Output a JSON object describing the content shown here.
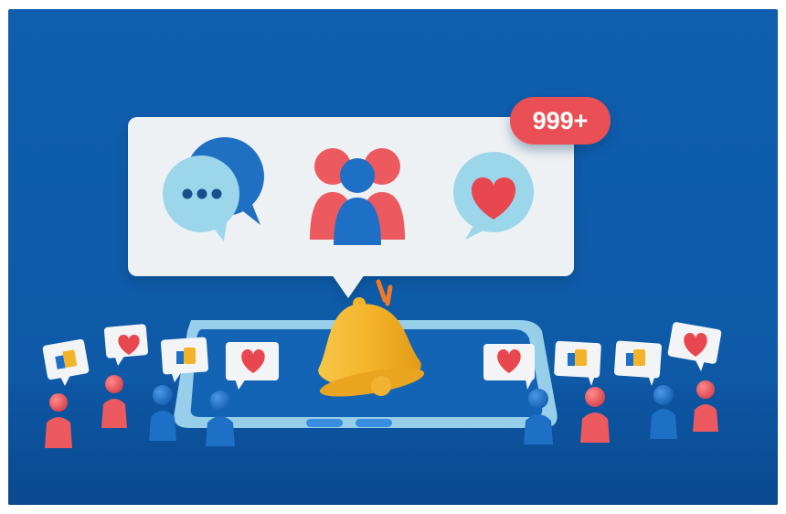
{
  "scene": {
    "notification_badge": {
      "text": "999+"
    },
    "icons": {
      "chat": "chat-bubble-icon",
      "group": "user-group-icon",
      "heart": "heart-bubble-icon",
      "bell": "notification-bell-icon",
      "like": "thumbs-up-icon"
    },
    "colors": {
      "background": "#0f5ba8",
      "floor": "#0b4f98",
      "card": "#eef1f4",
      "badge": "#ea4f55",
      "light_blue": "#8fd0e6",
      "coral": "#ec5a5f",
      "blue": "#1d70c6",
      "bell": "#f5b52d",
      "phone": "#9fd6ee"
    },
    "people_signs": [
      "like",
      "heart",
      "like",
      "heart",
      "heart",
      "like",
      "like",
      "heart"
    ]
  }
}
